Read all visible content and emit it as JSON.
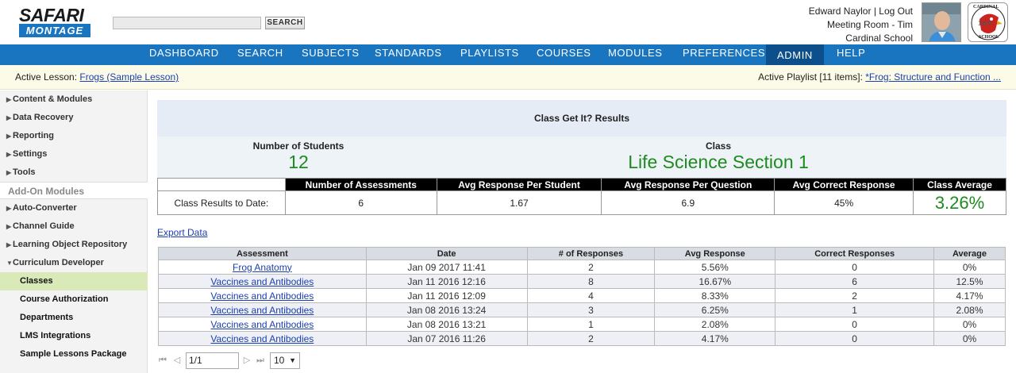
{
  "logo": {
    "top": "SAFARI",
    "bottom": "MONTAGE"
  },
  "search": {
    "placeholder": "",
    "button": "SEARCH"
  },
  "user": {
    "name": "Edward Naylor",
    "separator": "|",
    "logout": "Log Out",
    "room": "Meeting Room - Tim",
    "school": "Cardinal School"
  },
  "school_logo_text": {
    "top": "CARDINAL",
    "bottom": "SCHOOL",
    "year": "1885"
  },
  "nav": [
    "DASHBOARD",
    "SEARCH",
    "SUBJECTS",
    "STANDARDS",
    "PLAYLISTS",
    "COURSES",
    "MODULES",
    "PREFERENCES",
    "ADMIN",
    "HELP"
  ],
  "nav_active": "ADMIN",
  "lesson": {
    "label": "Active Lesson:",
    "link": "Frogs (Sample Lesson)"
  },
  "playlist": {
    "label": "Active Playlist [11 items]:",
    "link": "*Frog: Structure and Function ..."
  },
  "sidebar": {
    "items": [
      "Content & Modules",
      "Data Recovery",
      "Reporting",
      "Settings",
      "Tools"
    ],
    "section": "Add-On Modules",
    "addons": [
      "Auto-Converter",
      "Channel Guide",
      "Learning Object Repository",
      "Curriculum Developer"
    ],
    "subitems": [
      "Classes",
      "Course Authorization",
      "Departments",
      "LMS Integrations",
      "Sample Lessons Package"
    ]
  },
  "panel": {
    "title": "Class Get It? Results"
  },
  "summary": {
    "students_label": "Number of Students",
    "students_value": "12",
    "class_label": "Class",
    "class_value": "Life Science Section 1"
  },
  "results": {
    "headers": [
      "",
      "Number of Assessments",
      "Avg Response Per Student",
      "Avg Response Per Question",
      "Avg Correct Response",
      "Class Average"
    ],
    "row": [
      "Class Results to Date:",
      "6",
      "1.67",
      "6.9",
      "45%",
      "3.26%"
    ]
  },
  "export": "Export Data",
  "table": {
    "headers": [
      "Assessment",
      "Date",
      "# of Responses",
      "Avg Response",
      "Correct Responses",
      "Average"
    ],
    "rows": [
      [
        "Frog Anatomy",
        "Jan 09 2017 11:41",
        "2",
        "5.56%",
        "0",
        "0%"
      ],
      [
        "Vaccines and Antibodies",
        "Jan 11 2016 12:16",
        "8",
        "16.67%",
        "6",
        "12.5%"
      ],
      [
        "Vaccines and Antibodies",
        "Jan 11 2016 12:09",
        "4",
        "8.33%",
        "2",
        "4.17%"
      ],
      [
        "Vaccines and Antibodies",
        "Jan 08 2016 13:24",
        "3",
        "6.25%",
        "1",
        "2.08%"
      ],
      [
        "Vaccines and Antibodies",
        "Jan 08 2016 13:21",
        "1",
        "2.08%",
        "0",
        "0%"
      ],
      [
        "Vaccines and Antibodies",
        "Jan 07 2016 11:26",
        "2",
        "4.17%",
        "0",
        "0%"
      ]
    ]
  },
  "pager": {
    "page": "1/1",
    "per_page": "10"
  },
  "colors": {
    "brand_blue": "#1a75c0",
    "nav_active": "#0d4f8a",
    "highlight_green": "#1f8a1f",
    "link": "#1a3fb0"
  }
}
